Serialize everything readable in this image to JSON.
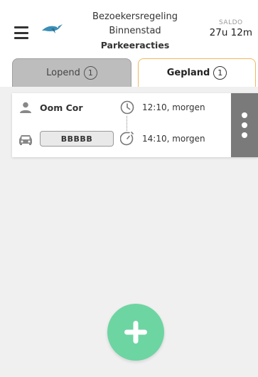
{
  "header": {
    "title_line1": "Bezoekersregeling",
    "title_line2": "Binnenstad",
    "subtitle": "Parkeeracties",
    "saldo_label": "SALDO",
    "saldo_value": "27u 12m"
  },
  "tabs": [
    {
      "label": "Lopend",
      "count": "1",
      "active": false
    },
    {
      "label": "Gepland",
      "count": "1",
      "active": true
    }
  ],
  "actions": [
    {
      "visitor_name": "Oom Cor",
      "plate": "BBBBB",
      "start_time": "12:10, morgen",
      "end_time": "14:10, morgen"
    }
  ],
  "icons": {
    "menu": "hamburger-menu-icon",
    "logo": "bird-logo-icon",
    "person": "person-icon",
    "car": "car-icon",
    "clock": "clock-icon",
    "timer": "timer-icon",
    "more": "more-vertical-icon",
    "add": "plus-icon"
  },
  "colors": {
    "accent_tab_border": "#f0b860",
    "inactive_tab": "#bdbdbd",
    "fab": "#6dd5a2",
    "card_menu": "#7a7a7a",
    "logo": "#3a8fb7"
  }
}
